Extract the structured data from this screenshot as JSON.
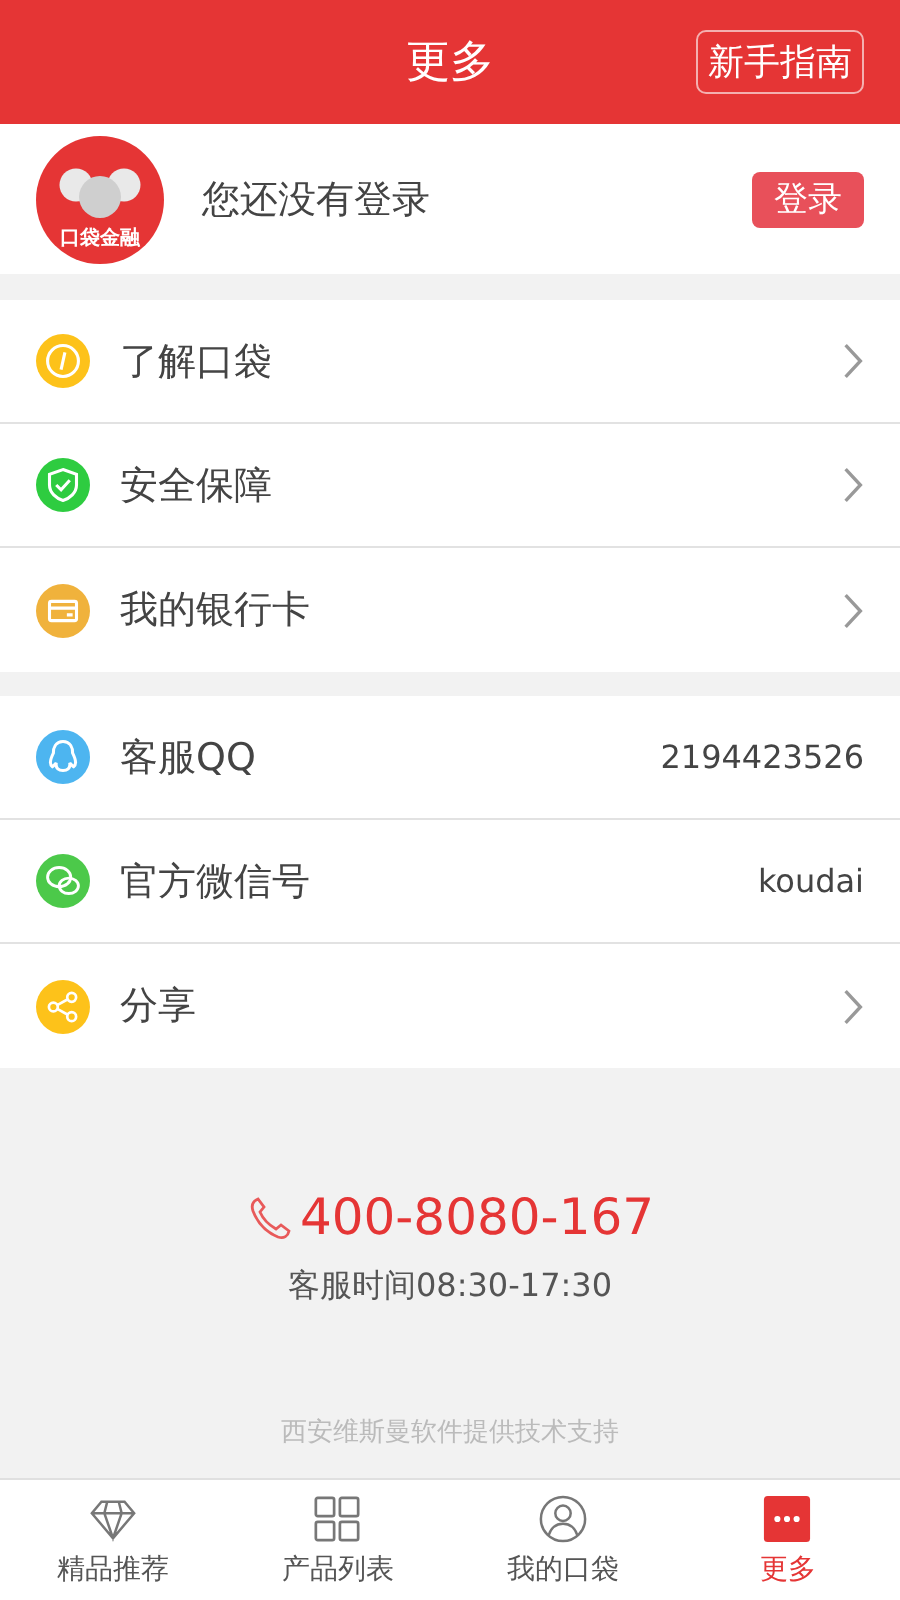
{
  "header": {
    "title": "更多",
    "guide_button": "新手指南"
  },
  "profile": {
    "logo_text": "口袋金融",
    "status": "您还没有登录",
    "login_button": "登录"
  },
  "groups": [
    {
      "items": [
        {
          "kind": "link",
          "label": "了解口袋",
          "color": "#fdc21a"
        },
        {
          "kind": "link",
          "label": "安全保障",
          "color": "#2ecc40"
        },
        {
          "kind": "link",
          "label": "我的银行卡",
          "color": "#f0b23c"
        }
      ]
    },
    {
      "items": [
        {
          "kind": "info",
          "label": "客服QQ",
          "value": "2194423526",
          "color": "#4db5f0"
        },
        {
          "kind": "info",
          "label": "官方微信号",
          "value": "koudai",
          "color": "#4cc94a"
        },
        {
          "kind": "link",
          "label": "分享",
          "color": "#fdc21a"
        }
      ]
    }
  ],
  "contact": {
    "phone": "400-8080-167",
    "hours": "客服时间08:30-17:30",
    "credit": "西安维斯曼软件提供技术支持"
  },
  "tabs": [
    {
      "label": "精品推荐",
      "selected": false
    },
    {
      "label": "产品列表",
      "selected": false
    },
    {
      "label": "我的口袋",
      "selected": false
    },
    {
      "label": "更多",
      "selected": true
    }
  ]
}
